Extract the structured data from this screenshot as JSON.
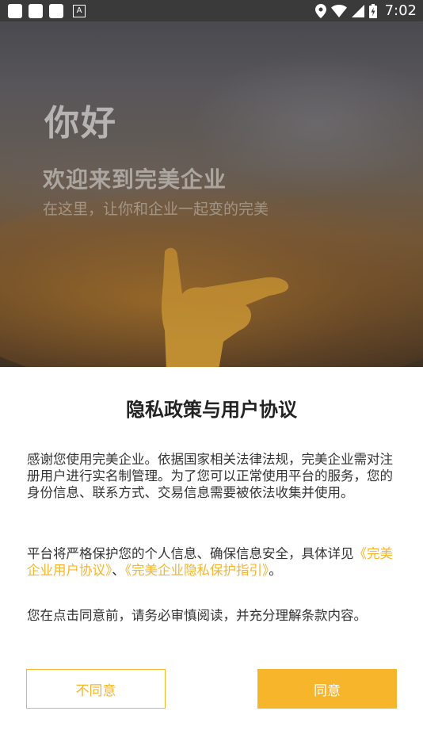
{
  "status_bar": {
    "time": "7:02",
    "icons": [
      "notification-square-icon",
      "notification-square-icon",
      "notification-square-icon",
      "a-badge-icon",
      "location-icon",
      "wifi-icon",
      "signal-icon",
      "battery-charging-icon"
    ],
    "a_badge": "A"
  },
  "hero": {
    "greeting": "你好",
    "welcome": "欢迎来到完美企业",
    "slogan": "在这里，让你和企业一起变的完美"
  },
  "dialog": {
    "title": "隐私政策与用户协议",
    "paragraph1": "感谢您使用完美企业。依据国家相关法律法规，完美企业需对注册用户进行实名制管理。为了您可以正常使用平台的服务，您的身份信息、联系方式、交易信息需要被依法收集并使用。",
    "paragraph2_prefix": "平台将严格保护您的个人信息、确保信息安全，具体详见",
    "link_user_agreement": "《完美企业用户协议》",
    "separator": "、",
    "link_privacy": "《完美企业隐私保护指引》",
    "paragraph2_suffix": "。",
    "paragraph3": "您在点击同意前，请务必审慎阅读，并充分理解条款内容。",
    "disagree_label": "不同意",
    "agree_label": "同意"
  },
  "colors": {
    "accent": "#f7b52c",
    "status_bar": "#3a3a3a"
  }
}
